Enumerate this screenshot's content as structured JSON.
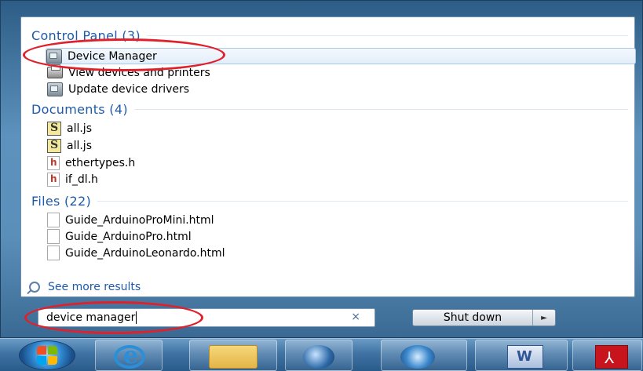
{
  "groups": [
    {
      "header": "Control Panel (3)",
      "items": [
        {
          "label": "Device Manager",
          "icon": "device-manager-icon",
          "selected": true
        },
        {
          "label": "View devices and printers",
          "icon": "printer-icon",
          "selected": false
        },
        {
          "label": "Update device drivers",
          "icon": "device-manager-icon",
          "selected": false
        }
      ]
    },
    {
      "header": "Documents (4)",
      "items": [
        {
          "label": "all.js",
          "icon": "js-file-icon"
        },
        {
          "label": "all.js",
          "icon": "js-file-icon"
        },
        {
          "label": "ethertypes.h",
          "icon": "header-file-icon"
        },
        {
          "label": "if_dl.h",
          "icon": "header-file-icon"
        }
      ]
    },
    {
      "header": "Files (22)",
      "items": [
        {
          "label": "Guide_ArduinoProMini.html",
          "icon": "file-icon"
        },
        {
          "label": "Guide_ArduinoPro.html",
          "icon": "file-icon"
        },
        {
          "label": "Guide_ArduinoLeonardo.html",
          "icon": "file-icon"
        }
      ]
    }
  ],
  "see_more": "See more results",
  "search": {
    "value": "device manager",
    "clear_glyph": "×"
  },
  "shutdown": {
    "label": "Shut down",
    "arrow": "►"
  },
  "annotation_color": "#e0202a",
  "taskbar": {
    "items": [
      "start-button",
      "internet-explorer",
      "windows-explorer",
      "network-app",
      "thunderbird",
      "microsoft-word",
      "adobe-reader"
    ]
  }
}
